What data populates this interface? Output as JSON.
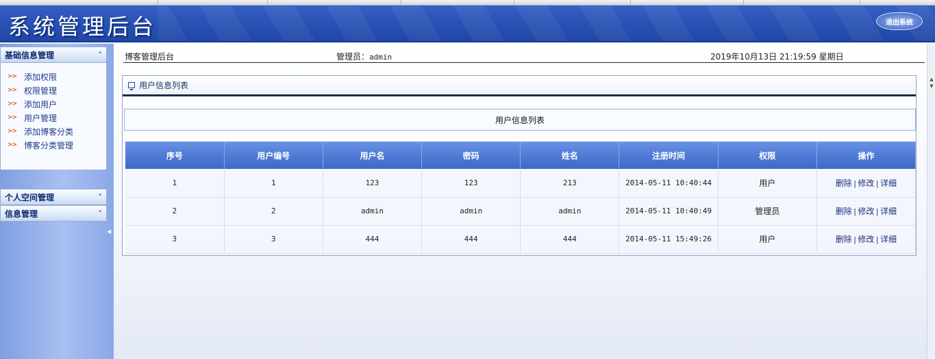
{
  "header": {
    "title": "系统管理后台",
    "logout_label": "退出系统"
  },
  "sidebar": {
    "sections": [
      {
        "label": "基础信息管理",
        "chevron": "˄",
        "items": [
          {
            "label": "添加权限"
          },
          {
            "label": "权限管理"
          },
          {
            "label": "添加用户"
          },
          {
            "label": "用户管理"
          },
          {
            "label": "添加博客分类"
          },
          {
            "label": "博客分类管理"
          }
        ]
      },
      {
        "label": "个人空间管理",
        "chevron": "˅"
      },
      {
        "label": "信息管理",
        "chevron": "˅"
      }
    ],
    "item_arrow": ">>"
  },
  "infobar": {
    "breadcrumb": "博客管理后台",
    "admin_label": "管理员：",
    "admin_value": "admin",
    "datetime": "2019年10月13日 21:19:59 星期日"
  },
  "panel": {
    "title": "用户信息列表",
    "table_title": "用户信息列表",
    "columns": [
      "序号",
      "用户编号",
      "用户名",
      "密码",
      "姓名",
      "注册时间",
      "权限",
      "操作"
    ],
    "rows": [
      {
        "seq": "1",
        "id": "1",
        "username": "123",
        "password": "123",
        "name": "213",
        "registered": "2014-05-11 10:40:44",
        "role": "用户"
      },
      {
        "seq": "2",
        "id": "2",
        "username": "admin",
        "password": "admin",
        "name": "admin",
        "registered": "2014-05-11 10:40:49",
        "role": "管理员"
      },
      {
        "seq": "3",
        "id": "3",
        "username": "444",
        "password": "444",
        "name": "444",
        "registered": "2014-05-11 15:49:26",
        "role": "用户"
      }
    ],
    "actions": {
      "delete": "删除",
      "edit": "修改",
      "detail": "详细",
      "separator": "|"
    }
  },
  "colors": {
    "header_blue": "#2b55b8",
    "table_head_blue": "#4d79d4",
    "link_blue": "#1e2f7a",
    "sidebar_arrow": "#e05a1d"
  }
}
